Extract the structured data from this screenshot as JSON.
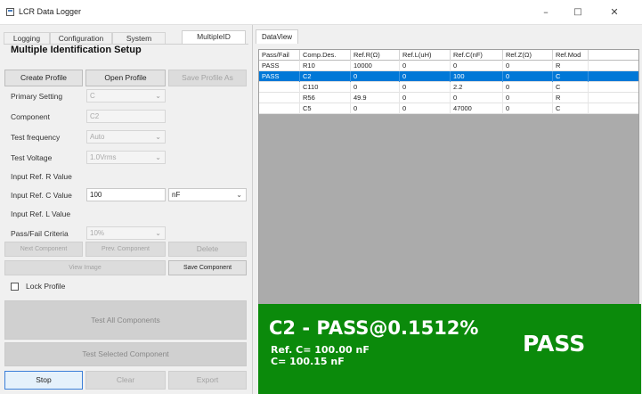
{
  "window": {
    "title": "LCR Data Logger",
    "controls": {
      "minimize": "–",
      "maximize": "□",
      "close": "✕"
    }
  },
  "tabs": [
    "Logging",
    "Configuration",
    "System",
    "MultipleID"
  ],
  "active_tab": "MultipleID",
  "setup": {
    "title": "Multiple Identification  Setup",
    "buttons": {
      "create_profile": "Create Profile",
      "open_profile": "Open Profile",
      "save_profile_as": "Save Profile As"
    },
    "fields": {
      "primary_setting": {
        "label": "Primary Setting",
        "value": "C"
      },
      "component": {
        "label": "Component",
        "value": "C2"
      },
      "test_frequency": {
        "label": "Test frequency",
        "value": "Auto"
      },
      "test_voltage": {
        "label": "Test Voltage",
        "value": "1.0Vrms"
      },
      "ref_r": {
        "label": "Input Ref. R Value"
      },
      "ref_c": {
        "label": "Input Ref. C Value",
        "value": "100",
        "unit": "nF"
      },
      "ref_l": {
        "label": "Input Ref. L Value"
      },
      "pass_fail": {
        "label": "Pass/Fail Criteria",
        "value": "10%"
      }
    },
    "buttons2": {
      "next_component": "Next Component",
      "prev_component": "Prev. Component",
      "delete": "Delete",
      "view_image": "View Image",
      "save_component": "Save Component"
    },
    "lock_profile": {
      "label": "Lock Profile",
      "checked": false
    },
    "test_all": "Test All Components",
    "test_selected": "Test Selected Component",
    "bottom": {
      "stop": "Stop",
      "clear": "Clear",
      "export": "Export"
    }
  },
  "dataview": {
    "tab": "DataView",
    "columns": [
      "Pass/Fail",
      "Comp.Des.",
      "Ref.R(Ω)",
      "Ref.L(uH)",
      "Ref.C(nF)",
      "Ref.Z(Ω)",
      "Ref.Mod"
    ],
    "rows": [
      [
        "PASS",
        "R10",
        "10000",
        "0",
        "0",
        "0",
        "R"
      ],
      [
        "PASS",
        "C2",
        "0",
        "0",
        "100",
        "0",
        "C"
      ],
      [
        "",
        "C110",
        "0",
        "0",
        "2.2",
        "0",
        "C"
      ],
      [
        "",
        "R56",
        "49.9",
        "0",
        "0",
        "0",
        "R"
      ],
      [
        "",
        "C5",
        "0",
        "0",
        "47000",
        "0",
        "C"
      ]
    ],
    "selected_row": 1,
    "scroll": {
      "left": "<",
      "right": ">"
    }
  },
  "result": {
    "headline": "C2 - PASS@0.1512%",
    "ref_line": "Ref. C= 100.00 nF",
    "measured_line": "C= 100.15 nF",
    "status": "PASS",
    "color": "#0b8a0b"
  },
  "colors": {
    "selection": "#0078d7",
    "grid_bg": "#ababab",
    "pass_green": "#0b8a0b"
  }
}
